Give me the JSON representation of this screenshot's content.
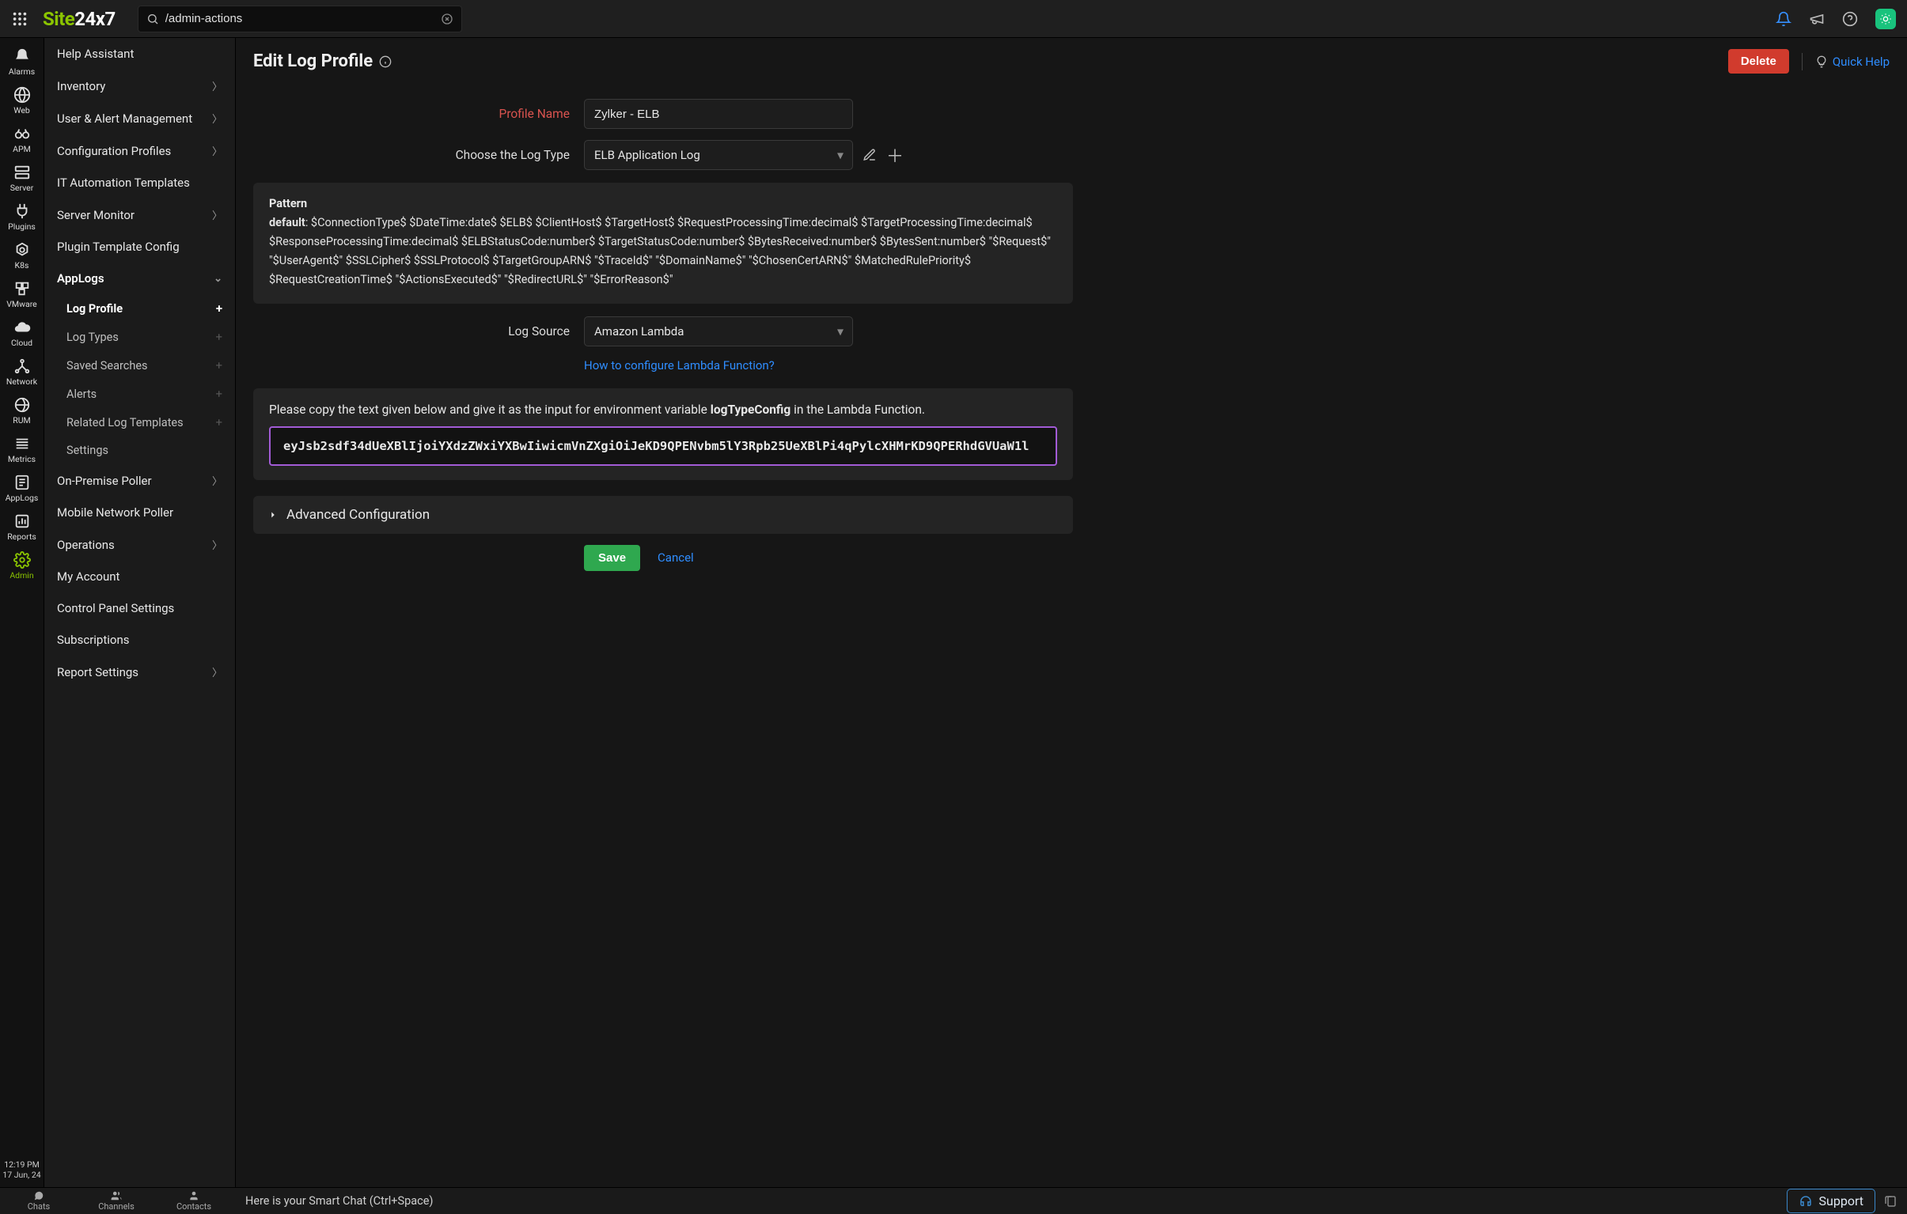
{
  "topbar": {
    "logo_green": "Site",
    "logo_white": "24x7",
    "search_value": "/admin-actions"
  },
  "rail": {
    "items": [
      {
        "label": "Alarms"
      },
      {
        "label": "Web"
      },
      {
        "label": "APM"
      },
      {
        "label": "Server"
      },
      {
        "label": "Plugins"
      },
      {
        "label": "K8s"
      },
      {
        "label": "VMware"
      },
      {
        "label": "Cloud"
      },
      {
        "label": "Network"
      },
      {
        "label": "RUM"
      },
      {
        "label": "Metrics"
      },
      {
        "label": "AppLogs"
      },
      {
        "label": "Reports"
      },
      {
        "label": "Admin"
      }
    ],
    "time": "12:19 PM",
    "date": "17 Jun, 24"
  },
  "nav2": {
    "items": [
      {
        "label": "Help Assistant",
        "chev": false
      },
      {
        "label": "Inventory",
        "chev": true
      },
      {
        "label": "User & Alert Management",
        "chev": true
      },
      {
        "label": "Configuration Profiles",
        "chev": true
      },
      {
        "label": "IT Automation Templates",
        "chev": false
      },
      {
        "label": "Server Monitor",
        "chev": true
      },
      {
        "label": "Plugin Template Config",
        "chev": false
      },
      {
        "label": "AppLogs",
        "chev": true,
        "expanded": true
      },
      {
        "label": "On-Premise Poller",
        "chev": true
      },
      {
        "label": "Mobile Network Poller",
        "chev": false
      },
      {
        "label": "Operations",
        "chev": true
      },
      {
        "label": "My Account",
        "chev": false
      },
      {
        "label": "Control Panel Settings",
        "chev": false
      },
      {
        "label": "Subscriptions",
        "chev": false
      },
      {
        "label": "Report Settings",
        "chev": true
      }
    ],
    "sub": [
      {
        "label": "Log Profile",
        "active": true,
        "plus": "+"
      },
      {
        "label": "Log Types",
        "plusdim": "+"
      },
      {
        "label": "Saved Searches",
        "plusdim": "+"
      },
      {
        "label": "Alerts",
        "plusdim": "+"
      },
      {
        "label": "Related Log Templates",
        "plusdim": "+"
      },
      {
        "label": "Settings"
      }
    ]
  },
  "page": {
    "title": "Edit Log Profile",
    "delete": "Delete",
    "quick_help": "Quick Help",
    "labels": {
      "profile_name": "Profile Name",
      "log_type": "Choose the Log Type",
      "log_source": "Log Source"
    },
    "values": {
      "profile_name": "Zylker - ELB",
      "log_type": "ELB Application Log",
      "log_source": "Amazon Lambda"
    },
    "pattern": {
      "head": "Pattern",
      "prefix": "default",
      "body": ": $ConnectionType$ $DateTime:date$ $ELB$ $ClientHost$ $TargetHost$ $RequestProcessingTime:decimal$ $TargetProcessingTime:decimal$ $ResponseProcessingTime:decimal$ $ELBStatusCode:number$ $TargetStatusCode:number$ $BytesReceived:number$ $BytesSent:number$ \"$Request$\" \"$UserAgent$\" $SSLCipher$ $SSLProtocol$ $TargetGroupARN$ \"$TraceId$\" \"$DomainName$\" \"$ChosenCertARN$\" $MatchedRulePriority$ $RequestCreationTime$ \"$ActionsExecuted$\" \"$RedirectURL$\" \"$ErrorReason$\""
    },
    "lambda_help": "How to configure Lambda Function?",
    "copy": {
      "text_pre": "Please copy the text given below and give it as the input for environment variable ",
      "text_var": "logTypeConfig",
      "text_post": " in the Lambda Function.",
      "token": "eyJsb2sdf34dUeXBlIjoiYXdzZWxiYXBwIiwicmVnZXgiOiJeKD9QPENvbm5lY3Rpb25UeXBlPi4qPylcXHMrKD9QPERhdGVUaW1l"
    },
    "accordion": "Advanced Configuration",
    "save": "Save",
    "cancel": "Cancel"
  },
  "bottombar": {
    "tabs": [
      "Chats",
      "Channels",
      "Contacts"
    ],
    "status": "Here is your Smart Chat (Ctrl+Space)",
    "support": "Support"
  }
}
